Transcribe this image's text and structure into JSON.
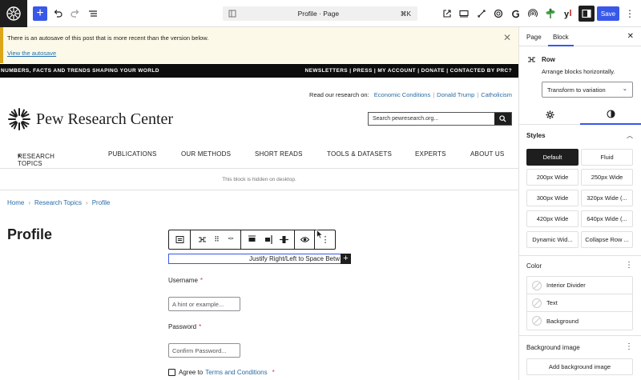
{
  "topbar": {
    "document_title": "Profile · Page",
    "shortcut": "⌘K",
    "save_label": "Save"
  },
  "notice": {
    "message": "There is an autosave of this post that is more recent than the version below.",
    "link": "View the autosave"
  },
  "site": {
    "top_bar_left": "NUMBERS, FACTS AND TRENDS SHAPING YOUR WORLD",
    "top_bar_right": "NEWSLETTERS | PRESS | MY ACCOUNT | DONATE | CONTACTED BY PRC?",
    "read_label": "Read our research on:",
    "read_links": [
      "Economic Conditions",
      "Donald Trump",
      "Catholicism"
    ],
    "logo_name": "Pew Research Center",
    "search_placeholder": "Search pewresearch.org...",
    "nav": [
      "RESEARCH TOPICS",
      "PUBLICATIONS",
      "OUR METHODS",
      "SHORT READS",
      "TOOLS & DATASETS",
      "EXPERTS",
      "ABOUT US"
    ],
    "hidden_block_text": "This block is hidden on desktop."
  },
  "breadcrumb": [
    "Home",
    "Research Topics",
    "Profile"
  ],
  "page": {
    "title": "Profile",
    "selected_row_text": "Justify Right/Left to  Space Betw",
    "username_label": "Username",
    "username_placeholder": "A hint or example...",
    "password_label": "Password",
    "password_placeholder": "Confirm Password...",
    "agree_prefix": "Agree to",
    "agree_link": "Terms and Conditions",
    "required_mark": "*"
  },
  "sidebar": {
    "tabs": [
      "Page",
      "Block"
    ],
    "active_tab": "Block",
    "block_name": "Row",
    "block_desc": "Arrange blocks horizontally.",
    "transform_label": "Transform to variation",
    "styles_title": "Styles",
    "styles": [
      "Default",
      "Fluid",
      "200px Wide",
      "250px Wide",
      "300px Wide",
      "320px Wide (...",
      "420px Wide",
      "640px Wide (...",
      "Dynamic Wid...",
      "Collapse Row ..."
    ],
    "active_style": "Default",
    "color_title": "Color",
    "colors": [
      "Interior Divider",
      "Text",
      "Background"
    ],
    "bg_image_title": "Background image",
    "bg_image_button": "Add background image"
  },
  "colors": {
    "accent": "#3858e9",
    "notice_border": "#dba617",
    "notice_bg": "#fcf9e8",
    "link": "#2a6ba4",
    "required": "#d63638"
  }
}
